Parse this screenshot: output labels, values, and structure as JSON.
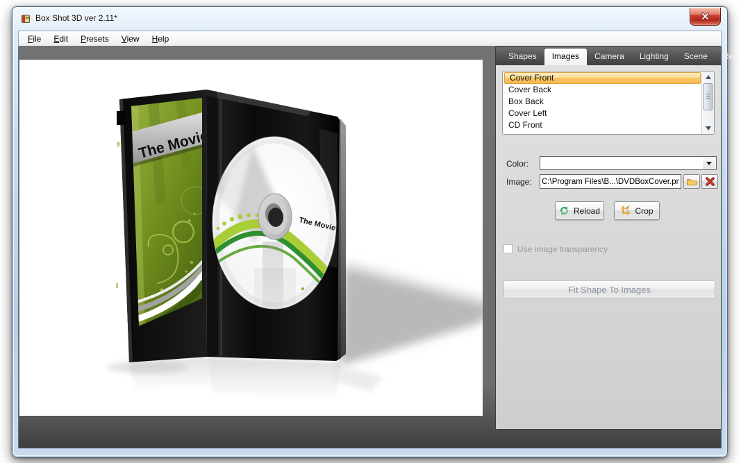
{
  "window": {
    "title": "Box Shot 3D ver 2.11*"
  },
  "menu": {
    "items": [
      {
        "hotkey": "F",
        "rest": "ile"
      },
      {
        "hotkey": "E",
        "rest": "dit"
      },
      {
        "hotkey": "P",
        "rest": "resets"
      },
      {
        "hotkey": "V",
        "rest": "iew"
      },
      {
        "hotkey": "H",
        "rest": "elp"
      }
    ]
  },
  "panel": {
    "tabs": [
      {
        "label": "Shapes"
      },
      {
        "label": "Images"
      },
      {
        "label": "Camera"
      },
      {
        "label": "Lighting"
      },
      {
        "label": "Scene"
      },
      {
        "label": "Render"
      }
    ],
    "active_tab": "Images",
    "images_list": {
      "items": [
        "Cover Front",
        "Cover Back",
        "Box Back",
        "Cover Left",
        "CD Front"
      ],
      "selected": "Cover Front"
    },
    "color": {
      "label": "Color:",
      "value": ""
    },
    "image": {
      "label": "Image:",
      "path": "C:\\Program Files\\B...\\DVDBoxCover.png"
    },
    "buttons": {
      "reload": "Reload",
      "crop": "Crop",
      "fit": "Fit Shape To Images"
    },
    "transparency_label": "Use image transparency"
  },
  "scene": {
    "cover_title": "The Movie",
    "disc_title": "The Movie"
  },
  "colors": {
    "selection_fill": "#F8C05F",
    "selection_border": "#DFA03D",
    "tab_bar": "#4B4B4B",
    "panel_bg": "#D6D6D6",
    "client_bg": "#6E6E6E",
    "close_button": "#C23325",
    "cover_green": "#74911F",
    "disc_band_green": "#A9CD36",
    "title_band_gray": "#BEBEBE"
  }
}
